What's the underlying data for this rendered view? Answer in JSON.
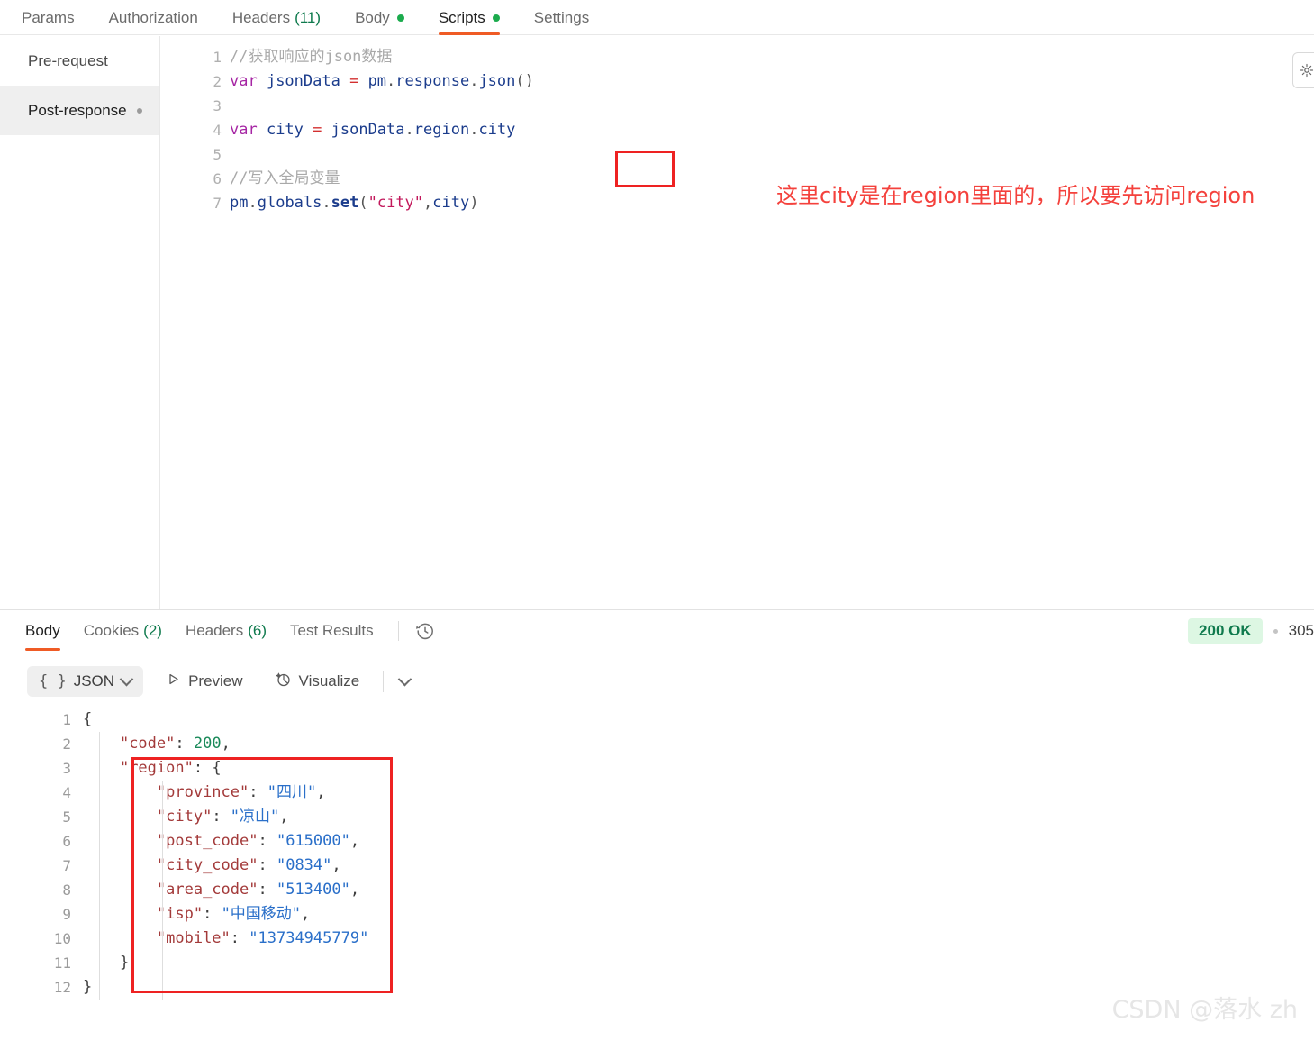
{
  "request_tabs": [
    {
      "label": "Params",
      "count": null,
      "dot": false,
      "active": false
    },
    {
      "label": "Authorization",
      "count": null,
      "dot": false,
      "active": false
    },
    {
      "label": "Headers",
      "count": "(11)",
      "dot": false,
      "active": false
    },
    {
      "label": "Body",
      "count": null,
      "dot": true,
      "active": false
    },
    {
      "label": "Scripts",
      "count": null,
      "dot": true,
      "active": true
    },
    {
      "label": "Settings",
      "count": null,
      "dot": false,
      "active": false
    }
  ],
  "script_sidebar": {
    "items": [
      {
        "label": "Pre-request",
        "selected": false,
        "dot": false
      },
      {
        "label": "Post-response",
        "selected": true,
        "dot": true
      }
    ]
  },
  "editor": {
    "side_button_icon": "snippet-icon",
    "annotation": "这里city是在region里面的，所以要先访问region",
    "highlight_word": "region",
    "lines": [
      {
        "n": "1",
        "tokens": [
          {
            "t": "//获取响应的json数据",
            "c": "tok-comment"
          }
        ]
      },
      {
        "n": "2",
        "tokens": [
          {
            "t": "var",
            "c": "tok-kw"
          },
          {
            "t": " jsonData ",
            "c": "tok-id"
          },
          {
            "t": "=",
            "c": "tok-op"
          },
          {
            "t": " pm",
            "c": "tok-id"
          },
          {
            "t": ".",
            "c": "tok-punct"
          },
          {
            "t": "response",
            "c": "tok-id"
          },
          {
            "t": ".",
            "c": "tok-punct"
          },
          {
            "t": "json",
            "c": "tok-id"
          },
          {
            "t": "()",
            "c": "tok-punct"
          }
        ]
      },
      {
        "n": "3",
        "tokens": []
      },
      {
        "n": "4",
        "tokens": [
          {
            "t": "var",
            "c": "tok-kw"
          },
          {
            "t": " city ",
            "c": "tok-id"
          },
          {
            "t": "=",
            "c": "tok-op"
          },
          {
            "t": " jsonData",
            "c": "tok-id"
          },
          {
            "t": ".",
            "c": "tok-punct"
          },
          {
            "t": "region",
            "c": "tok-id"
          },
          {
            "t": ".",
            "c": "tok-punct"
          },
          {
            "t": "city",
            "c": "tok-id"
          }
        ]
      },
      {
        "n": "5",
        "tokens": []
      },
      {
        "n": "6",
        "tokens": [
          {
            "t": "//写入全局变量",
            "c": "tok-comment"
          }
        ]
      },
      {
        "n": "7",
        "tokens": [
          {
            "t": "pm",
            "c": "tok-id"
          },
          {
            "t": ".",
            "c": "tok-punct"
          },
          {
            "t": "globals",
            "c": "tok-id"
          },
          {
            "t": ".",
            "c": "tok-punct"
          },
          {
            "t": "set",
            "c": "tok-fn"
          },
          {
            "t": "(",
            "c": "tok-punct"
          },
          {
            "t": "\"city\"",
            "c": "tok-str"
          },
          {
            "t": ",",
            "c": "tok-punct"
          },
          {
            "t": "city",
            "c": "tok-id"
          },
          {
            "t": ")",
            "c": "tok-punct"
          }
        ]
      }
    ]
  },
  "response": {
    "tabs": [
      {
        "label": "Body",
        "count": null,
        "active": true
      },
      {
        "label": "Cookies",
        "count": "(2)",
        "active": false
      },
      {
        "label": "Headers",
        "count": "(6)",
        "active": false
      },
      {
        "label": "Test Results",
        "count": null,
        "active": false
      }
    ],
    "history_icon": "history-clock-icon",
    "status_code": "200 OK",
    "time": "305 ",
    "toolbar": {
      "format_icon": "braces-icon",
      "format_label": "JSON",
      "preview_icon": "play-triangle-icon",
      "preview_label": "Preview",
      "visualize_icon": "visualize-icon",
      "visualize_label": "Visualize",
      "more_icon": "chevron-down-icon"
    },
    "json_lines": [
      {
        "n": "1",
        "indent": 0,
        "tokens": [
          {
            "t": "{",
            "c": "j-punct"
          }
        ]
      },
      {
        "n": "2",
        "indent": 1,
        "tokens": [
          {
            "t": "\"code\"",
            "c": "j-key"
          },
          {
            "t": ": ",
            "c": "j-punct"
          },
          {
            "t": "200",
            "c": "j-num"
          },
          {
            "t": ",",
            "c": "j-punct"
          }
        ]
      },
      {
        "n": "3",
        "indent": 1,
        "tokens": [
          {
            "t": "\"region\"",
            "c": "j-key"
          },
          {
            "t": ": {",
            "c": "j-punct"
          }
        ]
      },
      {
        "n": "4",
        "indent": 2,
        "tokens": [
          {
            "t": "\"province\"",
            "c": "j-key"
          },
          {
            "t": ": ",
            "c": "j-punct"
          },
          {
            "t": "\"四川\"",
            "c": "j-str"
          },
          {
            "t": ",",
            "c": "j-punct"
          }
        ]
      },
      {
        "n": "5",
        "indent": 2,
        "tokens": [
          {
            "t": "\"city\"",
            "c": "j-key"
          },
          {
            "t": ": ",
            "c": "j-punct"
          },
          {
            "t": "\"凉山\"",
            "c": "j-str"
          },
          {
            "t": ",",
            "c": "j-punct"
          }
        ]
      },
      {
        "n": "6",
        "indent": 2,
        "tokens": [
          {
            "t": "\"post_code\"",
            "c": "j-key"
          },
          {
            "t": ": ",
            "c": "j-punct"
          },
          {
            "t": "\"615000\"",
            "c": "j-str"
          },
          {
            "t": ",",
            "c": "j-punct"
          }
        ]
      },
      {
        "n": "7",
        "indent": 2,
        "tokens": [
          {
            "t": "\"city_code\"",
            "c": "j-key"
          },
          {
            "t": ": ",
            "c": "j-punct"
          },
          {
            "t": "\"0834\"",
            "c": "j-str"
          },
          {
            "t": ",",
            "c": "j-punct"
          }
        ]
      },
      {
        "n": "8",
        "indent": 2,
        "tokens": [
          {
            "t": "\"area_code\"",
            "c": "j-key"
          },
          {
            "t": ": ",
            "c": "j-punct"
          },
          {
            "t": "\"513400\"",
            "c": "j-str"
          },
          {
            "t": ",",
            "c": "j-punct"
          }
        ]
      },
      {
        "n": "9",
        "indent": 2,
        "tokens": [
          {
            "t": "\"isp\"",
            "c": "j-key"
          },
          {
            "t": ": ",
            "c": "j-punct"
          },
          {
            "t": "\"中国移动\"",
            "c": "j-str"
          },
          {
            "t": ",",
            "c": "j-punct"
          }
        ]
      },
      {
        "n": "10",
        "indent": 2,
        "tokens": [
          {
            "t": "\"mobile\"",
            "c": "j-key"
          },
          {
            "t": ": ",
            "c": "j-punct"
          },
          {
            "t": "\"13734945779\"",
            "c": "j-str"
          }
        ]
      },
      {
        "n": "11",
        "indent": 1,
        "tokens": [
          {
            "t": "}",
            "c": "j-punct"
          }
        ]
      },
      {
        "n": "12",
        "indent": 0,
        "tokens": [
          {
            "t": "}",
            "c": "j-punct"
          }
        ]
      }
    ]
  },
  "watermark": "CSDN @落水 zh",
  "colors": {
    "accent_orange": "#ef5b25",
    "status_green": "#0f7a4d",
    "status_bg": "#ddf7e3",
    "annotation_red": "#f4413c",
    "highlight_red": "#ee2222"
  }
}
